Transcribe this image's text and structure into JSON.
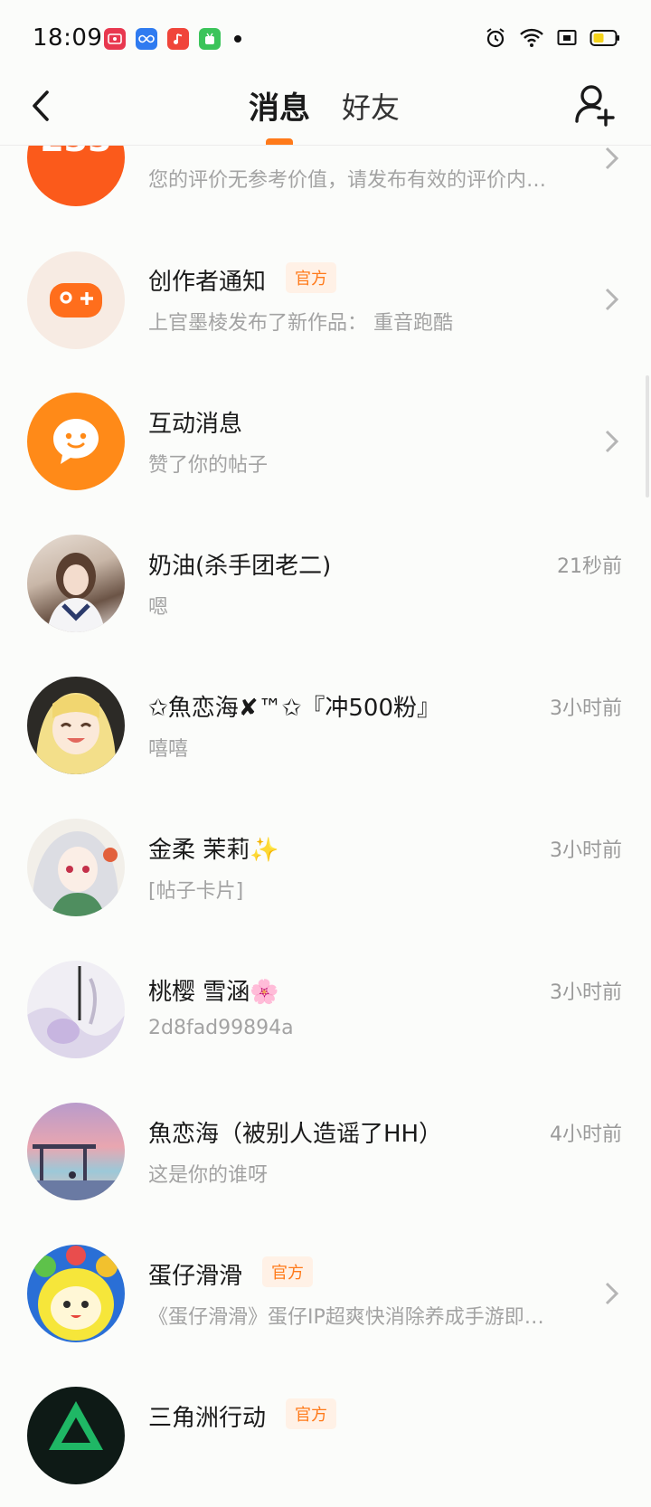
{
  "status_bar": {
    "time": "18:09",
    "apps": [
      {
        "icon": "video-app-icon",
        "color": "#e8384f"
      },
      {
        "icon": "infinity-app-icon",
        "color": "#2f7bf0"
      },
      {
        "icon": "music-app-icon",
        "color": "#f0453a"
      },
      {
        "icon": "android-app-icon",
        "color": "#3bc45a"
      }
    ],
    "right_icons": [
      "alarm-icon",
      "wifi-icon",
      "cast-icon",
      "battery-icon"
    ]
  },
  "header": {
    "back_icon": "back-arrow-icon",
    "tabs": [
      {
        "label": "消息",
        "active": true
      },
      {
        "label": "好友",
        "active": false
      }
    ],
    "add_friend_icon": "add-user-icon",
    "accent_color": "#ff7a1a"
  },
  "messages": [
    {
      "name": "",
      "preview": "您的评价无参考价值，请发布有效的评价内…",
      "time": "",
      "badge": "",
      "avatar": "233-logo-avatar",
      "chevron": true
    },
    {
      "name": "创作者通知",
      "preview": "上官墨棱发布了新作品： 重音跑酷",
      "time": "",
      "badge": "官方",
      "avatar": "gamepad-avatar",
      "chevron": true
    },
    {
      "name": "互动消息",
      "preview": "赞了你的帖子",
      "time": "",
      "badge": "",
      "avatar": "chat-bubble-avatar",
      "chevron": true
    },
    {
      "name": "奶油(杀手团老二)",
      "preview": "嗯",
      "time": "21秒前",
      "badge": "",
      "avatar": "user-avatar-1",
      "chevron": false
    },
    {
      "name": "✩魚恋海✘™✩『冲500粉』",
      "preview": "嘻嘻",
      "time": "3小时前",
      "badge": "",
      "avatar": "user-avatar-2",
      "chevron": false
    },
    {
      "name": "金柔 茉莉✨",
      "preview": "[帖子卡片]",
      "time": "3小时前",
      "badge": "",
      "avatar": "user-avatar-3",
      "chevron": false
    },
    {
      "name": "桃樱  雪涵🌸",
      "preview": "2d8fad99894a",
      "time": "3小时前",
      "badge": "",
      "avatar": "user-avatar-4",
      "chevron": false
    },
    {
      "name": "魚恋海（被别人造谣了HH）",
      "preview": "这是你的谁呀",
      "time": "4小时前",
      "badge": "",
      "avatar": "user-avatar-5",
      "chevron": false
    },
    {
      "name": "蛋仔滑滑",
      "preview": "《蛋仔滑滑》蛋仔IP超爽快消除养成手游即…",
      "time": "",
      "badge": "官方",
      "avatar": "egg-game-avatar",
      "chevron": true
    },
    {
      "name": "三角洲行动",
      "preview": "",
      "time": "",
      "badge": "官方",
      "avatar": "delta-game-avatar",
      "chevron": false
    }
  ]
}
